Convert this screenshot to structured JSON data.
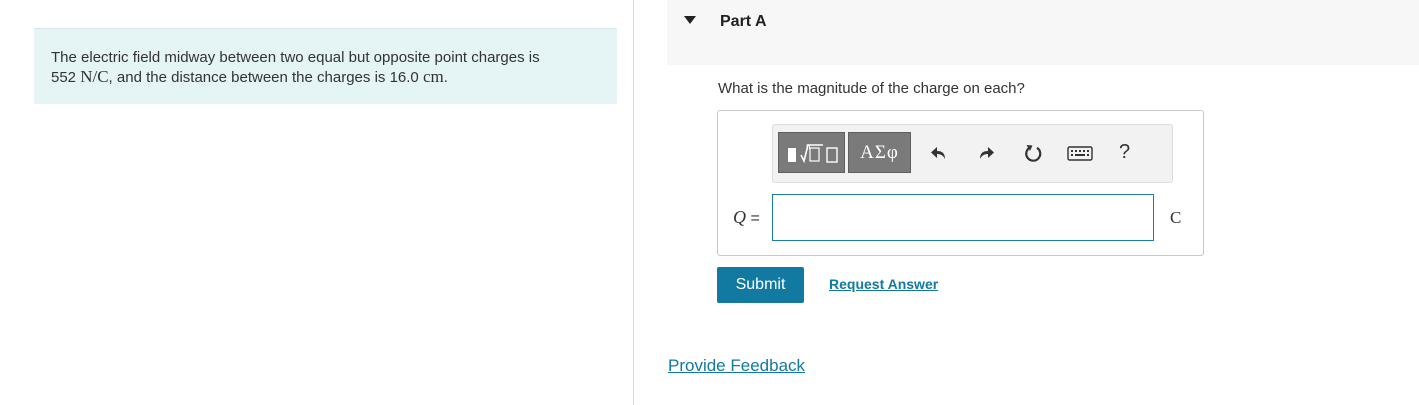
{
  "problem": {
    "line1": "The electric field midway between two equal but opposite point charges is",
    "field_value": "552",
    "field_unit": "N/C",
    "line2_middle": ", and the distance between the charges is",
    "distance_value": "16.0",
    "distance_unit": "cm",
    "line2_end": "."
  },
  "part": {
    "title": "Part A",
    "question": "What is the magnitude of the charge on each?"
  },
  "toolbar": {
    "symbols_label": "ΑΣφ",
    "help_label": "?",
    "icons": [
      "templates-icon",
      "undo-icon",
      "redo-icon",
      "reset-icon",
      "keyboard-icon",
      "help-icon"
    ]
  },
  "answer": {
    "variable": "Q",
    "equals": "=",
    "value": "",
    "unit": "C"
  },
  "actions": {
    "submit_label": "Submit",
    "request_answer_label": "Request Answer",
    "feedback_label": "Provide Feedback"
  },
  "colors": {
    "accent": "#1279a1",
    "problem_bg": "#e5f4f5",
    "header_bg": "#f7f7f7",
    "toolbar_button": "#7a7a7a"
  }
}
